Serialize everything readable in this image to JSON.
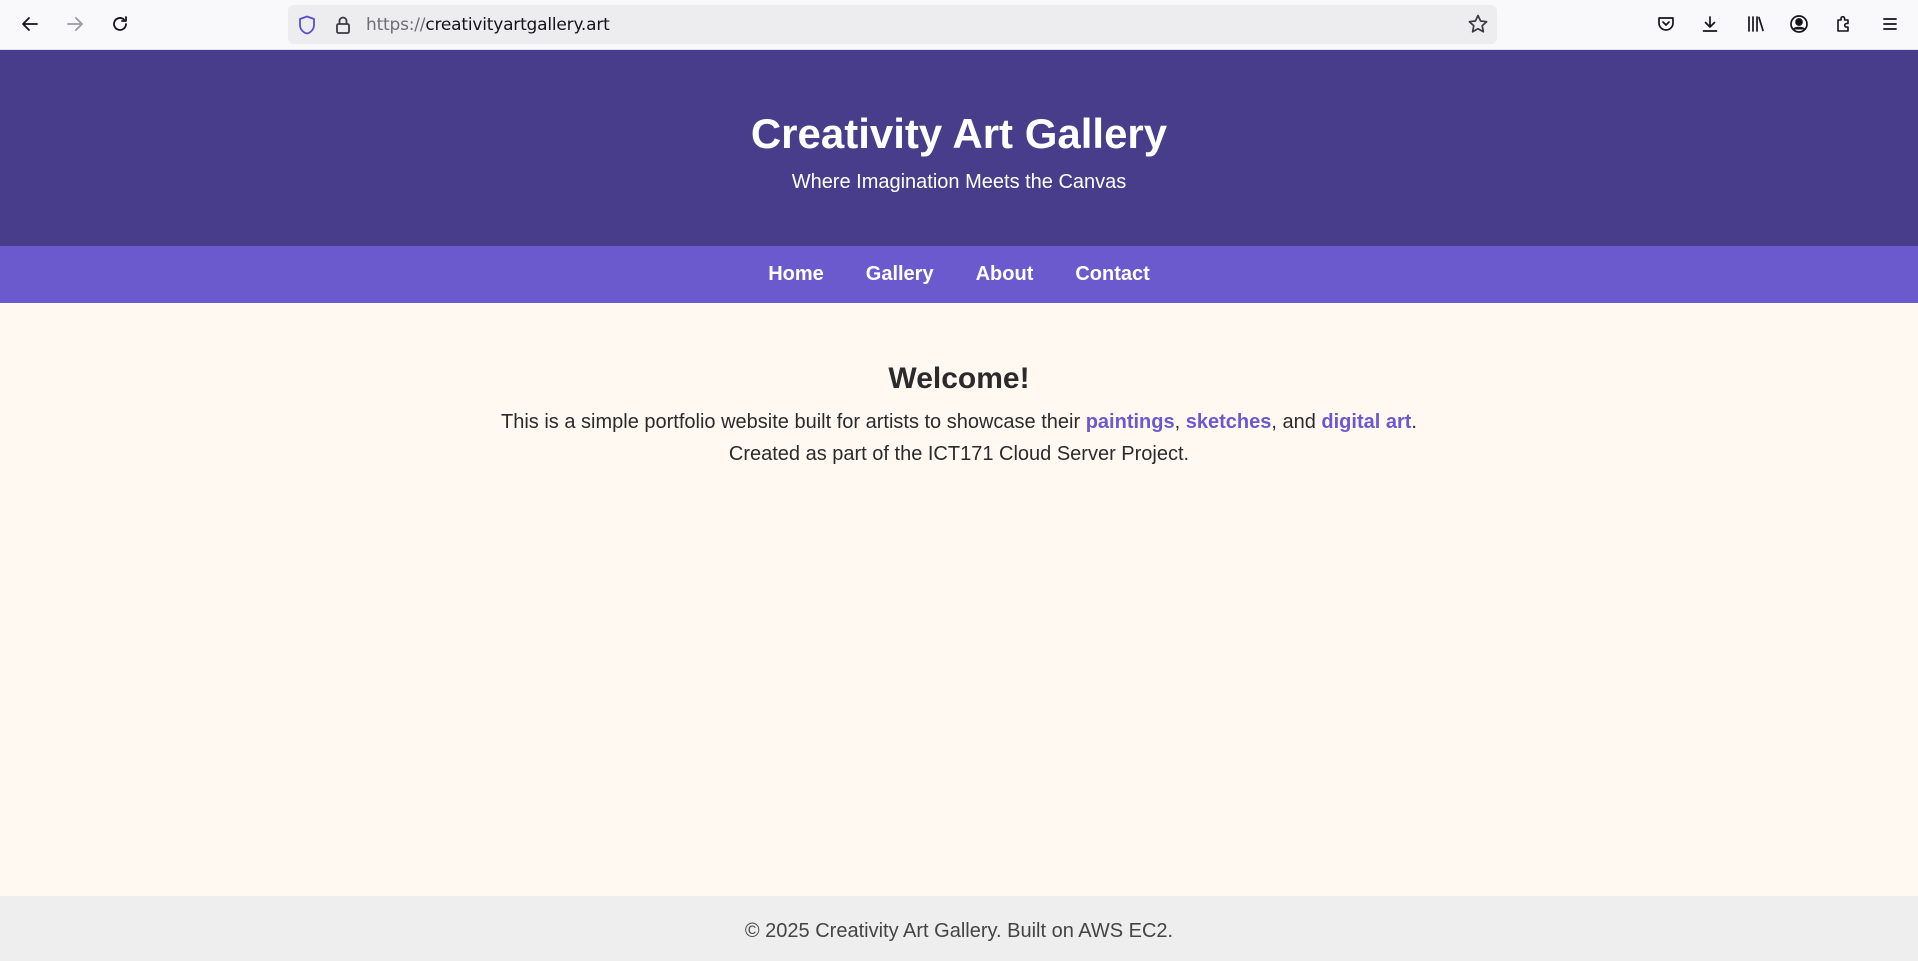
{
  "browser": {
    "url_scheme": "https://",
    "url_host": "creativityartgallery.art"
  },
  "header": {
    "title": "Creativity Art Gallery",
    "tagline": "Where Imagination Meets the Canvas"
  },
  "nav": {
    "items": [
      {
        "label": "Home"
      },
      {
        "label": "Gallery"
      },
      {
        "label": "About"
      },
      {
        "label": "Contact"
      }
    ]
  },
  "main": {
    "heading": "Welcome!",
    "intro_prefix": "This is a simple portfolio website built for artists to showcase their ",
    "link_paintings": "paintings",
    "sep1": ", ",
    "link_sketches": "sketches",
    "sep2": ", and ",
    "link_digital_art": "digital art",
    "intro_end": ".",
    "line2": "Created as part of the ICT171 Cloud Server Project."
  },
  "footer": {
    "text": "© 2025 Creativity Art Gallery. Built on AWS EC2."
  },
  "colors": {
    "header_bg": "#483d8b",
    "nav_bg": "#6a5acd",
    "page_bg": "#fff9f2",
    "link": "#6a5acd",
    "footer_bg": "#eeeeee"
  }
}
